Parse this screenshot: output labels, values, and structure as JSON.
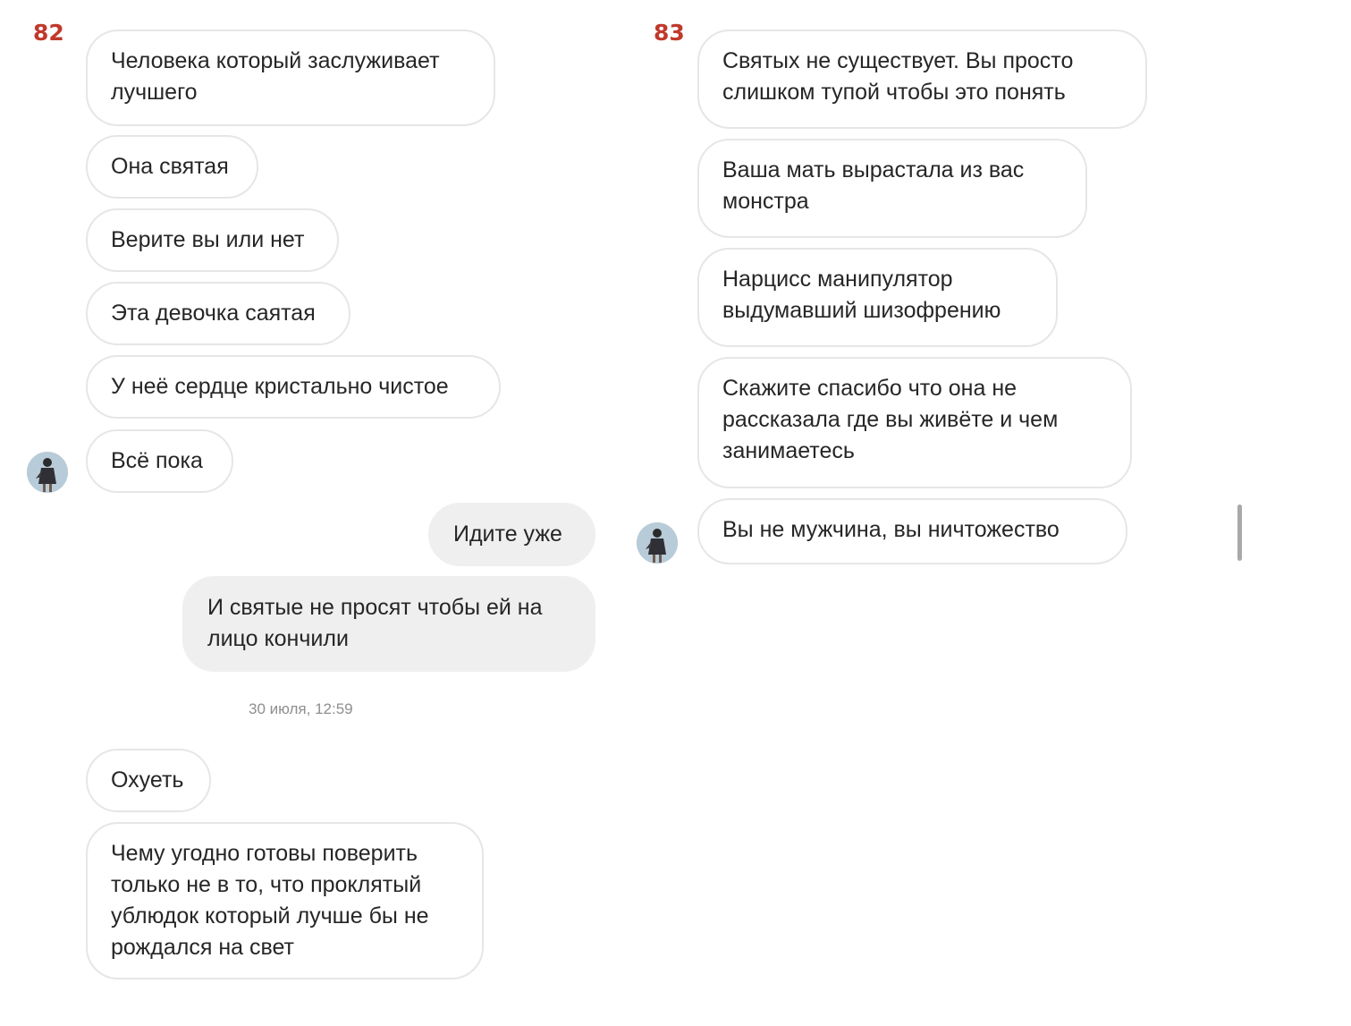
{
  "left_panel": {
    "page_number": "82",
    "received_messages": [
      "Человека который заслуживает\nлучшего",
      "Она святая",
      "Верите вы или нет",
      "Эта девочка саятая",
      "У неё сердце кристально чистое",
      "Всё пока"
    ],
    "sent_messages": [
      "Идите уже",
      "И святые не просят чтобы ей на\nлицо кончили"
    ],
    "timestamp": "30 июля, 12:59",
    "received_after": [
      "Охуеть",
      "Чему угодно готовы поверить\nтолько не в то, что проклятый\nублюдок который лучше бы не\nрождался на свет"
    ]
  },
  "right_panel": {
    "page_number": "83",
    "received_messages": [
      "Святых не существует. Вы просто\nслишком тупой чтобы это понять",
      "Ваша мать вырастала из вас\nмонстра",
      "Нарцисс манипулятор\nвыдумавший шизофрению",
      "Скажите спасибо что она не\nрассказала где вы живёте и чем\nзанимаетесь",
      "Вы не мужчина, вы ничтожество"
    ]
  },
  "colors": {
    "page_number": "#c0392b",
    "bubble_border": "#e6e6e6",
    "sent_bubble": "#efefef",
    "timestamp": "#8e8e8e"
  },
  "icons": {
    "avatar": "user-avatar-icon"
  }
}
